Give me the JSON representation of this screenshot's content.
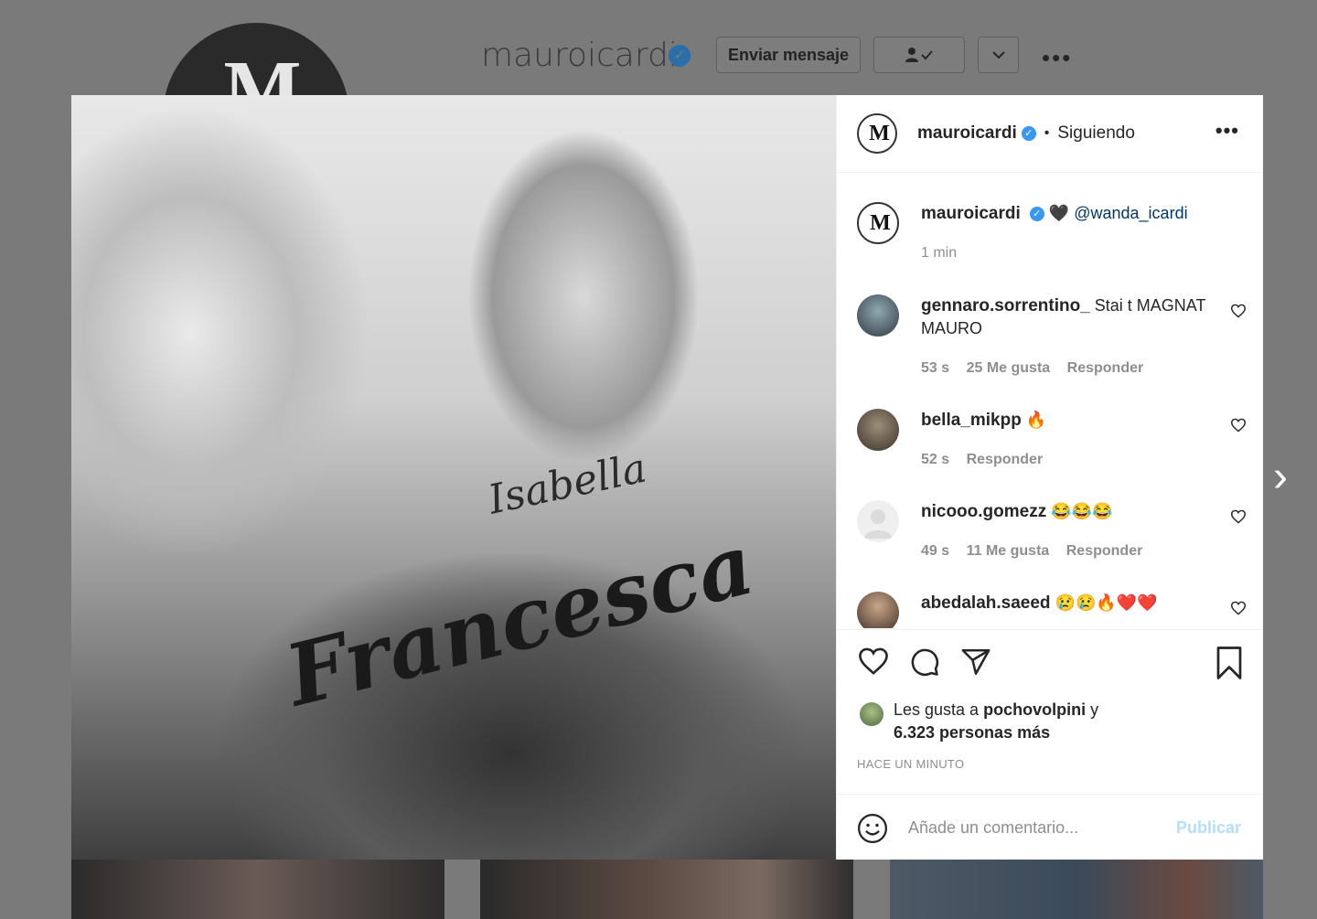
{
  "background": {
    "logo_text": "M",
    "profile_name": "mauroicardi",
    "send_message_label": "Enviar mensaje",
    "more_label": "•••",
    "next_label": "›"
  },
  "photo": {
    "tattoo_arm_text": "Isabella",
    "tattoo_chest_text": "Francesca"
  },
  "post": {
    "header": {
      "username": "mauroicardi",
      "separator": "•",
      "follow_status": "Siguiendo",
      "more_label": "•••",
      "avatar_text": "M"
    },
    "caption": {
      "username": "mauroicardi",
      "text": "🖤",
      "mention": "@wanda_icardi",
      "time": "1 min"
    },
    "comments": [
      {
        "username": "gennaro.sorrentino_",
        "text": "Stai t MAGNAT MAURO",
        "time": "53 s",
        "likes": "25 Me gusta",
        "reply": "Responder"
      },
      {
        "username": "bella_mikpp",
        "text": "🔥",
        "time": "52 s",
        "likes": "",
        "reply": "Responder"
      },
      {
        "username": "nicooo.gomezz",
        "text": "😂😂😂",
        "time": "49 s",
        "likes": "11 Me gusta",
        "reply": "Responder"
      },
      {
        "username": "abedalah.saeed",
        "text": "😢😢🔥❤️❤️",
        "time": "",
        "likes": "",
        "reply": ""
      }
    ],
    "likes": {
      "prefix": "Les gusta a",
      "user": "pochovolpini",
      "suffix": "y",
      "others": "6.323 personas más"
    },
    "timestamp": "HACE UN MINUTO",
    "add_comment": {
      "placeholder": "Añade un comentario...",
      "publish_label": "Publicar"
    }
  },
  "colors": {
    "overlay": "#7a7a7a",
    "text": "#262626",
    "muted": "#8e8e8e",
    "verified": "#3897f0",
    "link": "#00376b",
    "publish_disabled": "#b2dffc"
  }
}
